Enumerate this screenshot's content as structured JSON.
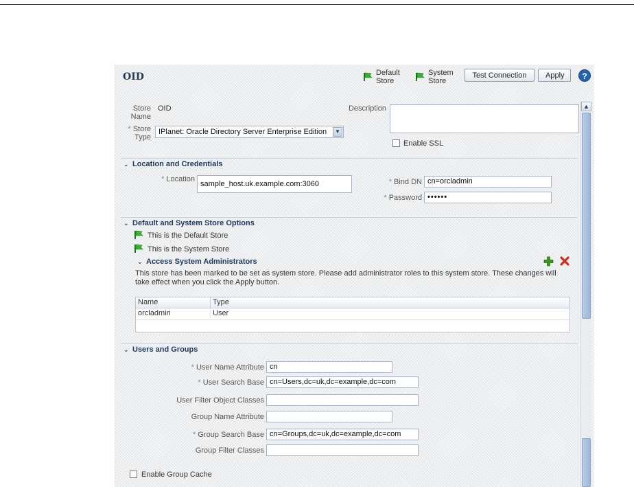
{
  "header": {
    "title": "OID",
    "default_store_label": "Default Store",
    "system_store_label": "System Store",
    "test_connection_label": "Test Connection",
    "apply_label": "Apply",
    "help_glyph": "?"
  },
  "store": {
    "name_label": "Store Name",
    "name_value": "OID",
    "type_label": "Store Type",
    "type_value": "IPlanet: Oracle Directory Server Enterprise Edition",
    "description_label": "Description",
    "description_value": "",
    "ssl_label": "Enable SSL",
    "ssl_checked": false
  },
  "location": {
    "section_title": "Location and Credentials",
    "location_label": "Location",
    "location_value": "sample_host.uk.example.com:3060",
    "bind_dn_label": "Bind DN",
    "bind_dn_value": "cn=orcladmin",
    "password_label": "Password",
    "password_value": "••••••"
  },
  "options": {
    "section_title": "Default and System Store Options",
    "default_note": "This is the Default Store",
    "system_note": "This is the System Store",
    "admins_title": "Access System Administrators",
    "admins_message": "This store has been marked to be set as system store. Please add administrator roles to this system store. These changes will take effect when you click the Apply button.",
    "table_columns": [
      "Name",
      "Type"
    ],
    "table_rows": [
      [
        "orcladmin",
        "User"
      ]
    ]
  },
  "users_groups": {
    "section_title": "Users and Groups",
    "user_name_attr_label": "User Name Attribute",
    "user_name_attr_value": "cn",
    "user_search_base_label": "User Search Base",
    "user_search_base_value": "cn=Users,dc=uk,dc=example,dc=com",
    "user_filter_label": "User Filter Object Classes",
    "user_filter_value": "",
    "group_name_attr_label": "Group Name Attribute",
    "group_name_attr_value": "",
    "group_search_base_label": "Group Search Base",
    "group_search_base_value": "cn=Groups,dc=uk,dc=example,dc=com",
    "group_filter_label": "Group Filter Classes",
    "group_filter_value": "",
    "group_cache_label": "Enable Group Cache",
    "group_cache_checked": false
  },
  "icons": {
    "flag": "green-flag-icon",
    "add": "add-icon",
    "delete": "delete-icon",
    "collapse": "collapse-arrow-icon"
  },
  "colors": {
    "title": "#1f3b60",
    "flag_green": "#2f9e2f",
    "add_green": "#3a9a1e",
    "delete_red": "#d42a1c",
    "help_blue": "#2563b0"
  }
}
